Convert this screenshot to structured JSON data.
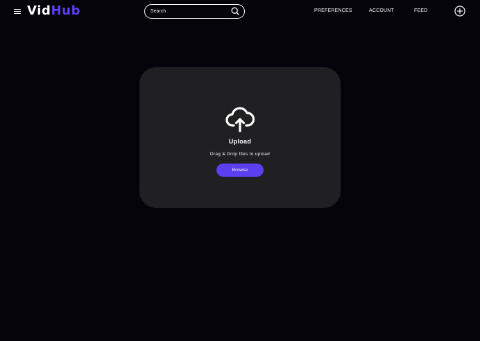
{
  "header": {
    "logo_part1": "Vid",
    "logo_part2": "Hub",
    "search": {
      "placeholder": "Search",
      "value": ""
    },
    "nav": {
      "preferences": "PREFERENCES",
      "account": "ACCOUNT",
      "feed": "FEED"
    },
    "icons": {
      "menu": "hamburger-menu-icon",
      "search": "search-icon",
      "add": "plus-circle-icon"
    }
  },
  "upload": {
    "icon": "cloud-upload-icon",
    "title": "Upload",
    "hint": "Drag & Drop files to upload",
    "browse_label": "Browse"
  },
  "colors": {
    "background": "#05040a",
    "card": "#202022",
    "accent": "#5b3ff0",
    "text": "#ffffff"
  }
}
